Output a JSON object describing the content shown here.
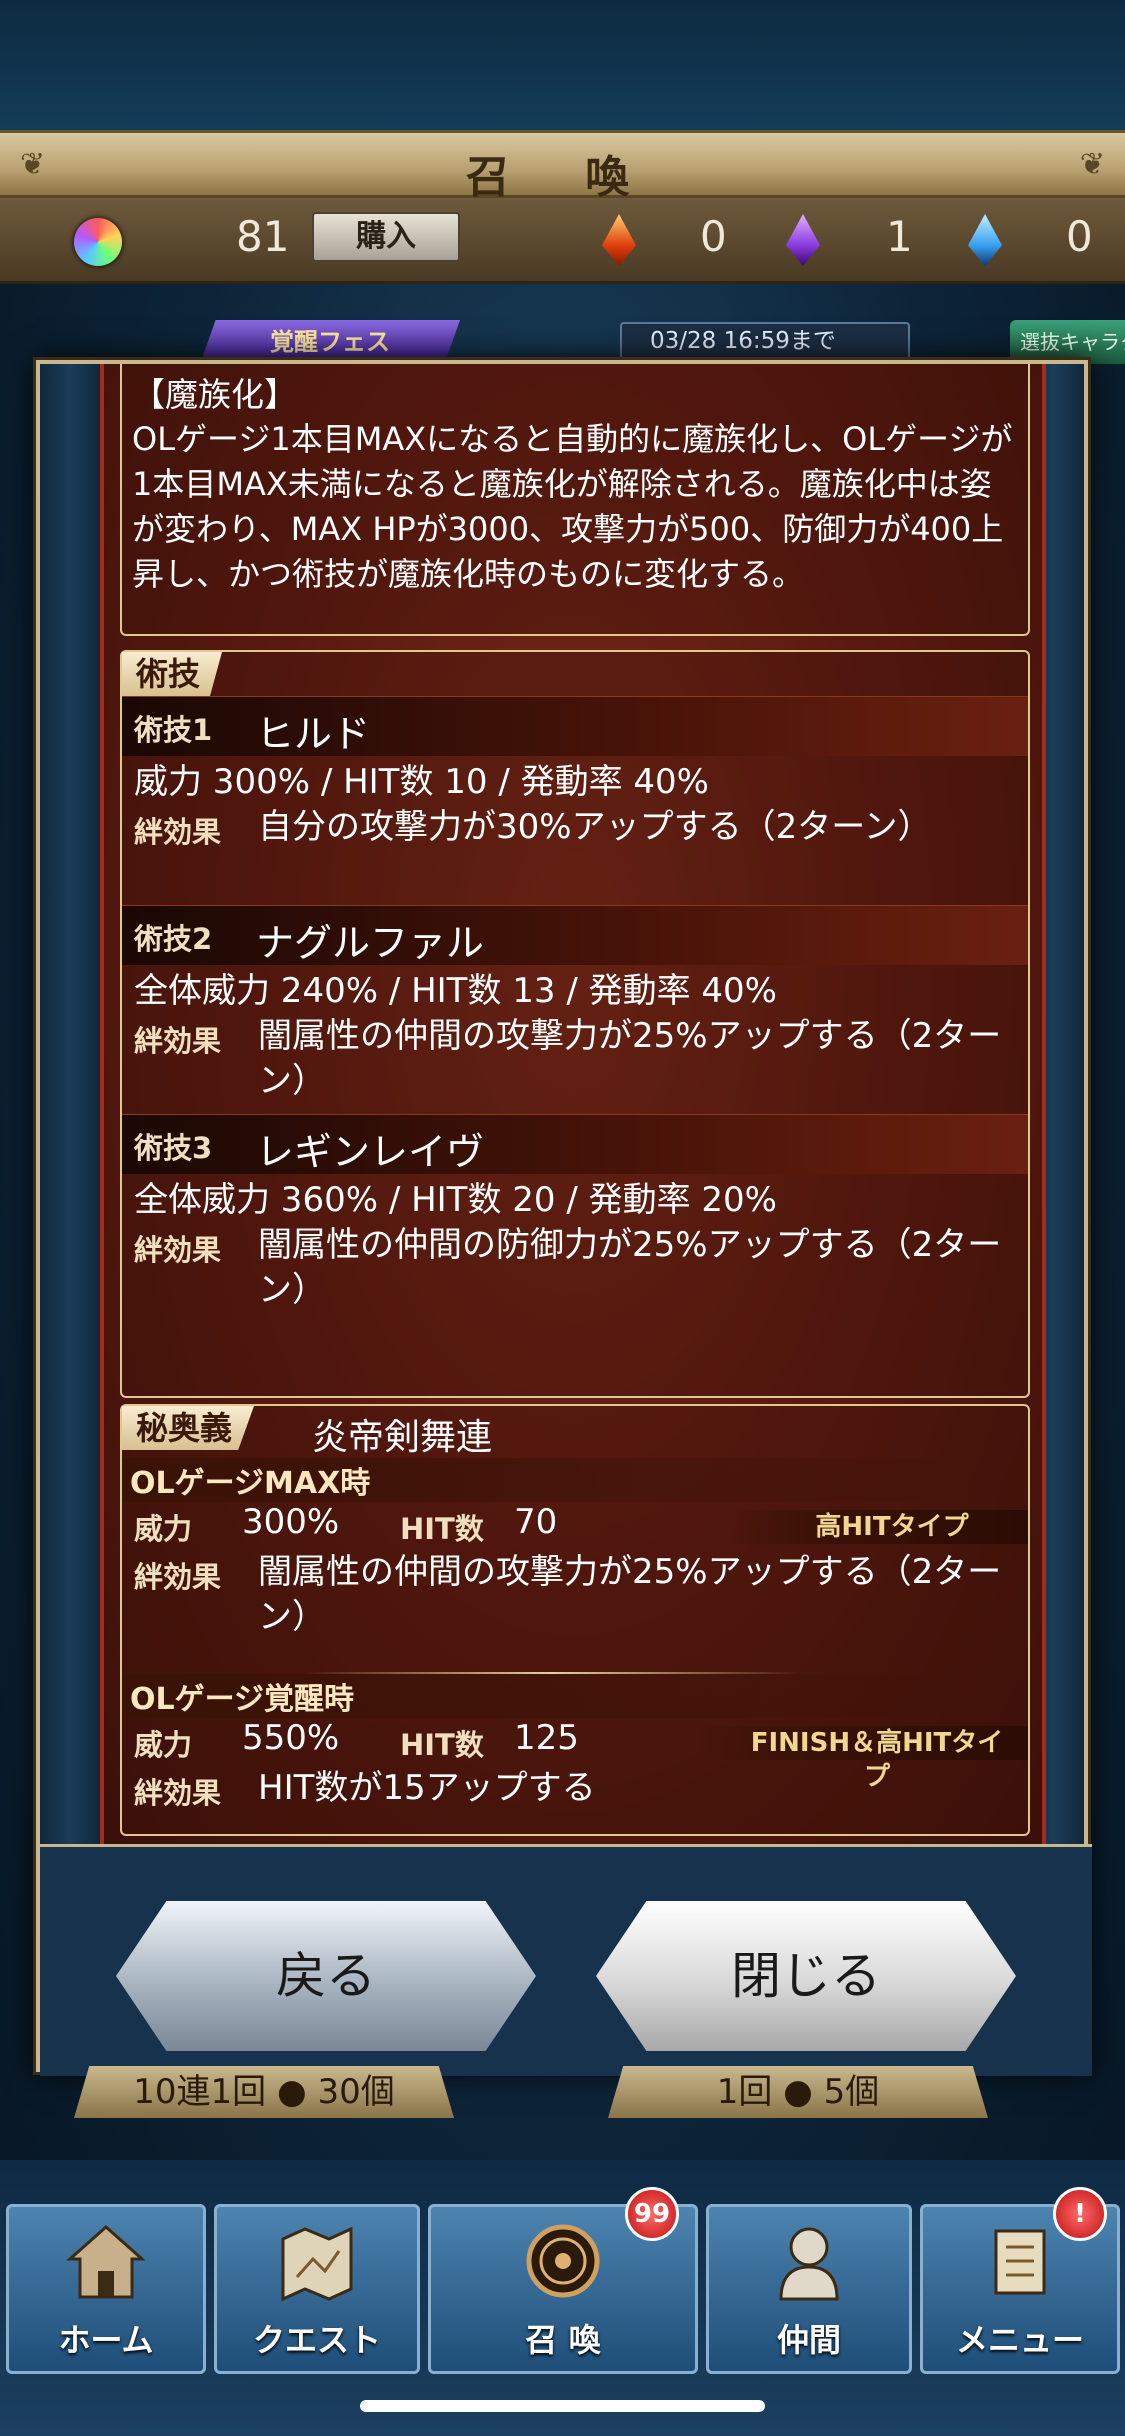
{
  "header": {
    "title": "召 喚"
  },
  "currency": {
    "orb_count": "81",
    "buy_label": "購入",
    "fire_count": "0",
    "dark_count": "1",
    "water_count": "0"
  },
  "banner": {
    "fes_label": "覚醒フェス",
    "deadline": "03/28 16:59まで",
    "select_label": "選抜キャラクタ"
  },
  "modal": {
    "ability": {
      "name": "【魔族化】",
      "description": "OLゲージ1本目MAXになると自動的に魔族化し、OLゲージが1本目MAX未満になると魔族化が解除される。魔族化中は姿が変わり、MAX HPが3000、攻撃力が500、防御力が400上昇し、かつ術技が魔族化時のものに変化する。"
    },
    "arts": {
      "section_label": "術技",
      "skills": [
        {
          "tag": "術技1",
          "name": "ヒルド",
          "stats": "威力 300% / HIT数 10 / 発動率 40%",
          "effect_label": "絆効果",
          "effect": "自分の攻撃力が30%アップする（2ターン）"
        },
        {
          "tag": "術技2",
          "name": "ナグルファル",
          "stats": "全体威力 240% / HIT数 13 / 発動率 40%",
          "effect_label": "絆効果",
          "effect": "闇属性の仲間の攻撃力が25%アップする（2ターン）"
        },
        {
          "tag": "術技3",
          "name": "レギンレイヴ",
          "stats": "全体威力 360% / HIT数 20 / 発動率 20%",
          "effect_label": "絆効果",
          "effect": "闇属性の仲間の防御力が25%アップする（2ターン）"
        }
      ]
    },
    "mystic": {
      "section_label": "秘奥義",
      "name": "炎帝剣舞連",
      "max": {
        "heading": "OLゲージMAX時",
        "power_label": "威力",
        "power": "300%",
        "hit_label": "HIT数",
        "hit": "70",
        "type": "高HITタイプ",
        "effect_label": "絆効果",
        "effect": "闇属性の仲間の攻撃力が25%アップする（2ターン）"
      },
      "awaken": {
        "heading": "OLゲージ覚醒時",
        "power_label": "威力",
        "power": "550%",
        "hit_label": "HIT数",
        "hit": "125",
        "type": "FINISH＆高HITタイプ",
        "effect_label": "絆効果",
        "effect": "HIT数が15アップする"
      }
    },
    "buttons": {
      "back": "戻る",
      "close": "閉じる"
    }
  },
  "under": {
    "left": "10連1回 ● 30個",
    "right": "1回 ● 5個"
  },
  "nav": {
    "items": [
      {
        "label": "ホーム"
      },
      {
        "label": "クエスト"
      },
      {
        "label": "召 喚",
        "badge": "99"
      },
      {
        "label": "仲間"
      },
      {
        "label": "メニュー",
        "badge": "!"
      }
    ]
  },
  "colors": {
    "accent_gold": "#c9b88e",
    "panel_red": "#5a1a10",
    "nav_blue": "#1e4e78"
  }
}
